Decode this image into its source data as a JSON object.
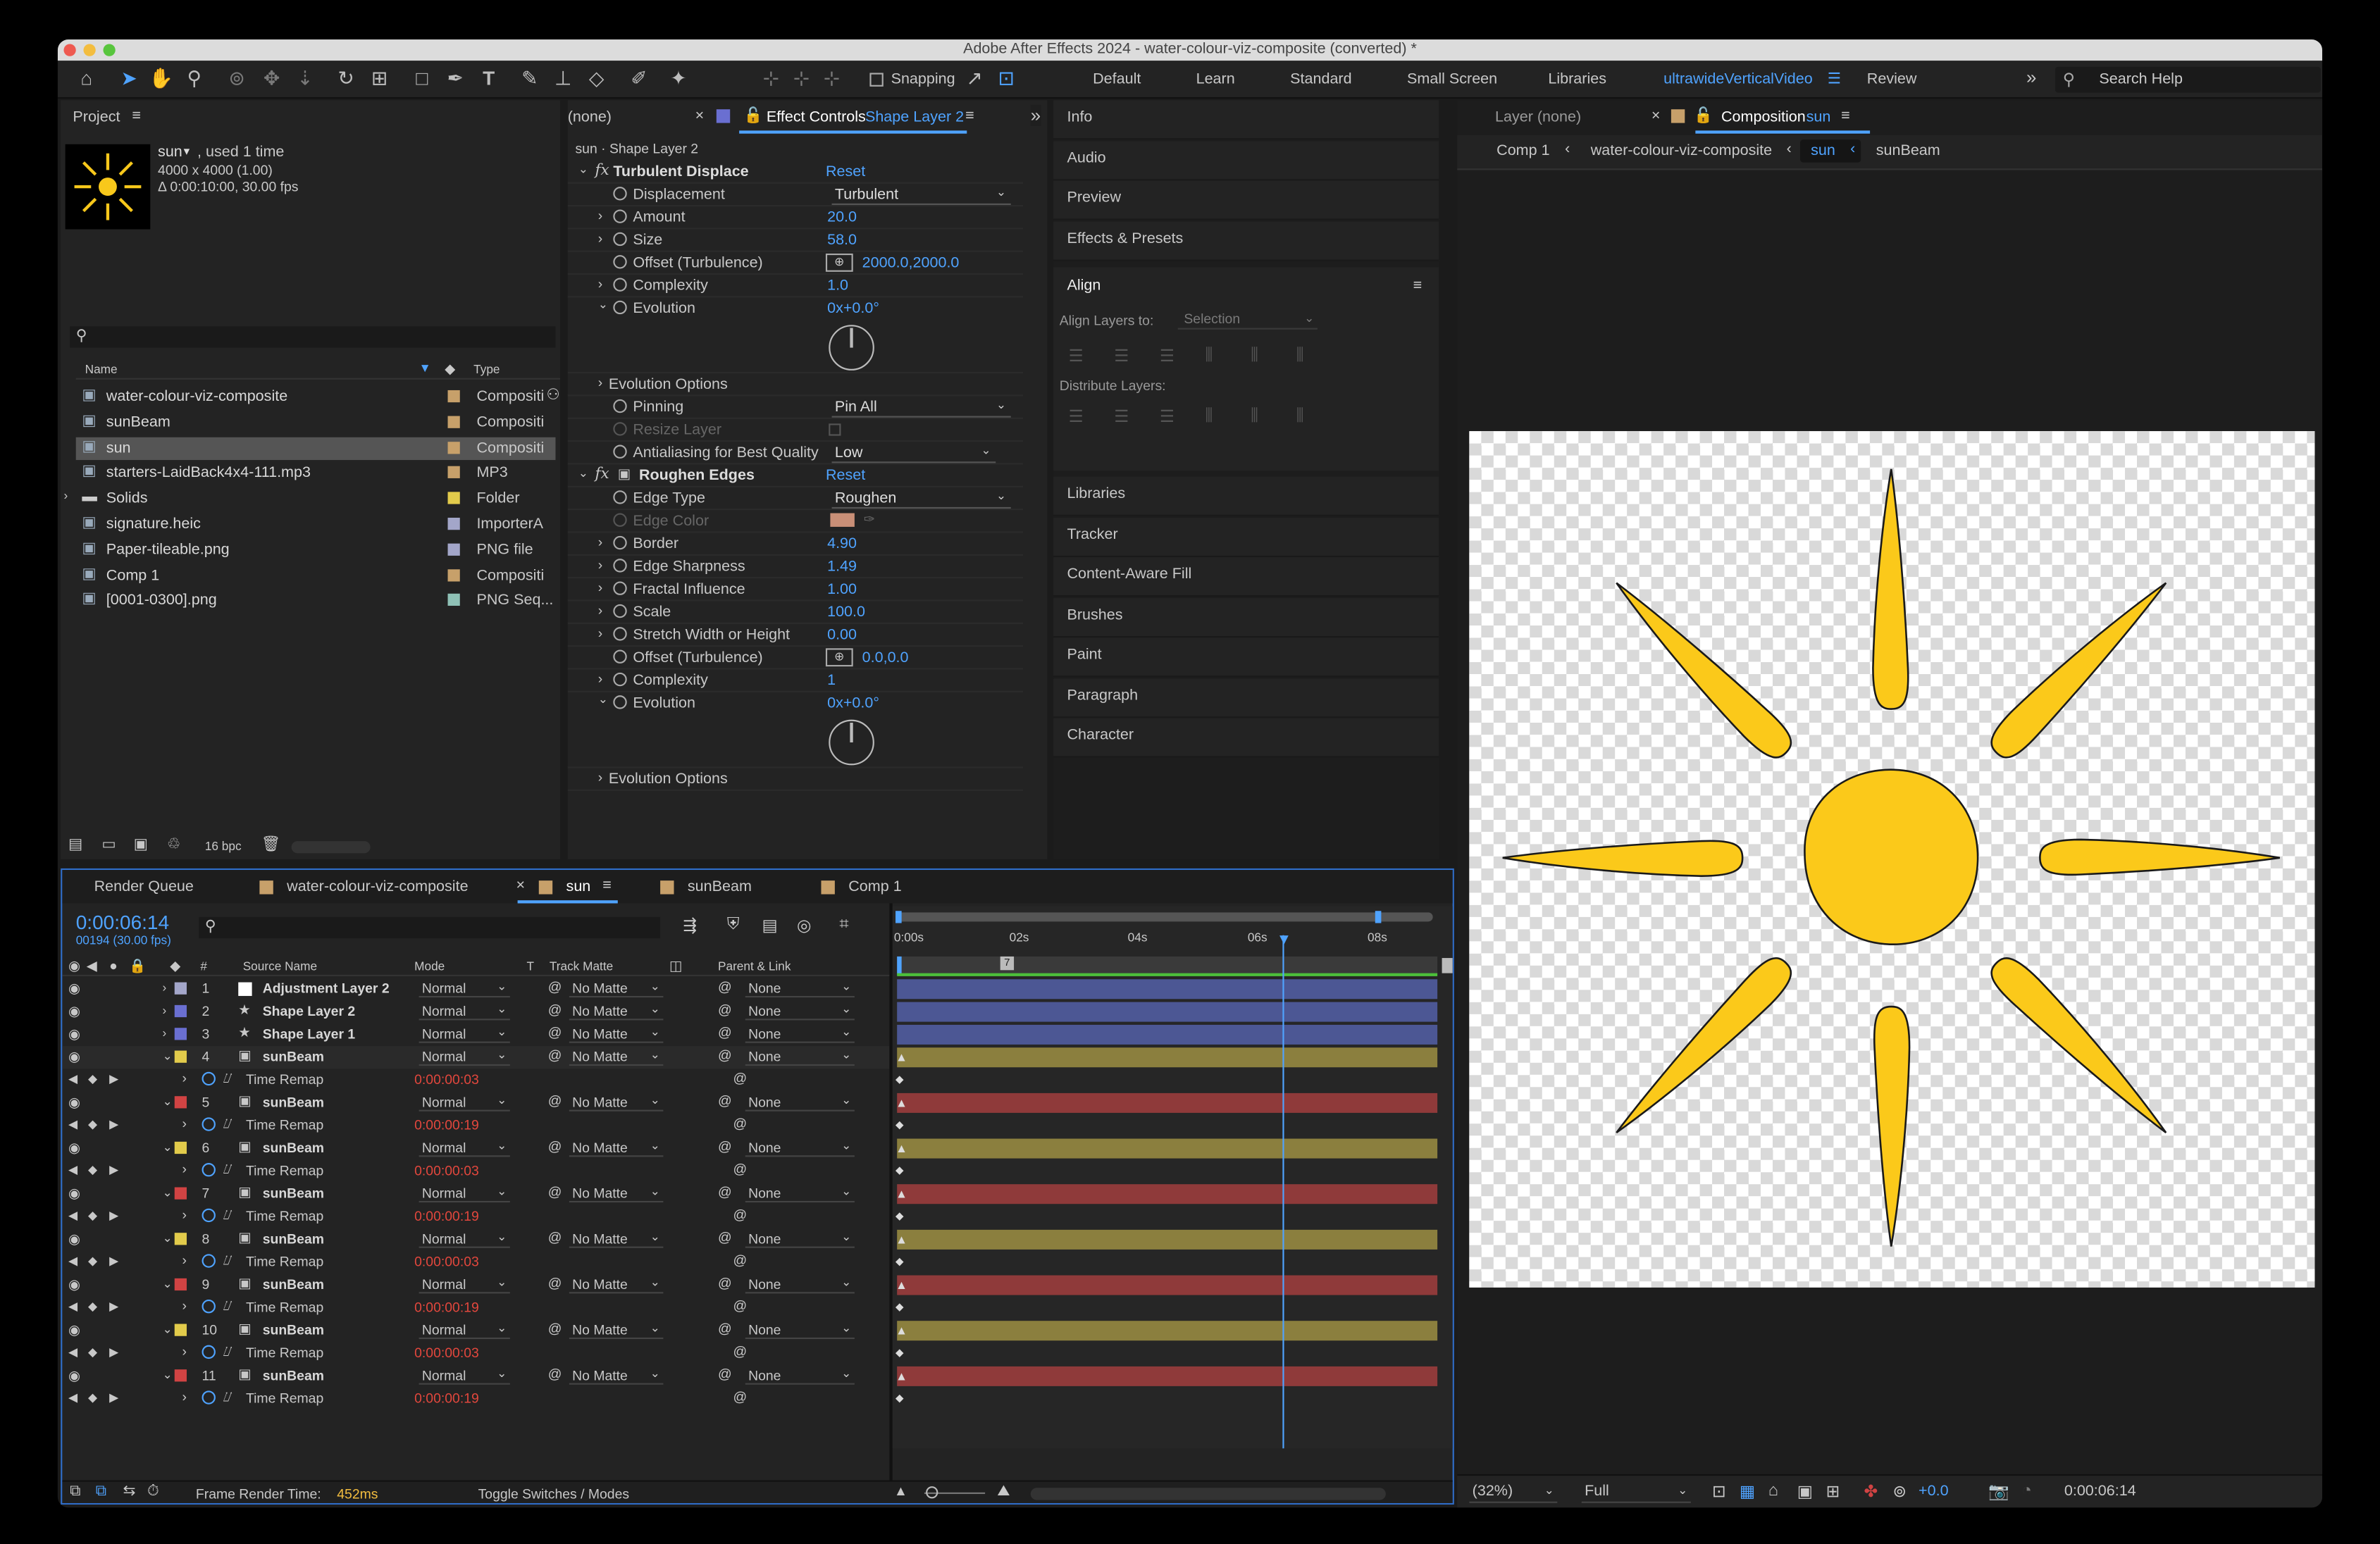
{
  "window": {
    "title": "Adobe After Effects 2024 - water-colour-viz-composite (converted) *"
  },
  "toolbar": {
    "snapping_label": "Snapping",
    "workspaces": [
      "Default",
      "Learn",
      "Standard",
      "Small Screen",
      "Libraries",
      "ultrawideVerticalVideo",
      "Review"
    ],
    "active_workspace": "ultrawideVerticalVideo",
    "search_placeholder": "Search Help",
    "overflow": "»"
  },
  "project": {
    "tab": "Project",
    "item_name": "sun",
    "item_used": ", used 1 time",
    "item_size": "4000 x 4000 (1.00)",
    "item_duration": "Δ 0:00:10:00, 30.00 fps",
    "col_name": "Name",
    "col_type": "Type",
    "items": [
      {
        "name": "water-colour-viz-composite",
        "type": "Compositi",
        "color": "#c7a06a"
      },
      {
        "name": "sunBeam",
        "type": "Compositi",
        "color": "#c7a06a"
      },
      {
        "name": "sun",
        "type": "Compositi",
        "color": "#c7a06a"
      },
      {
        "name": "starters-LaidBack4x4-111.mp3",
        "type": "MP3",
        "color": "#c7a06a"
      },
      {
        "name": "Solids",
        "type": "Folder",
        "color": "#e2cb4b"
      },
      {
        "name": "signature.heic",
        "type": "ImporterA",
        "color": "#a3a6c9"
      },
      {
        "name": "Paper-tileable.png",
        "type": "PNG file",
        "color": "#a3a6c9"
      },
      {
        "name": "Comp 1",
        "type": "Compositi",
        "color": "#c7a06a"
      },
      {
        "name": "[0001-0300].png",
        "type": "PNG Seq...",
        "color": "#8fc1b6"
      }
    ],
    "bpc": "16 bpc"
  },
  "effects": {
    "tab_left": "(none)",
    "tab_label": "Effect Controls",
    "tab_layer": "Shape Layer 2",
    "subtitle": "sun · Shape Layer 2",
    "group1": {
      "name": "Turbulent Displace",
      "reset": "Reset",
      "displacement_label": "Displacement",
      "displacement_value": "Turbulent",
      "amount_label": "Amount",
      "amount": "20.0",
      "size_label": "Size",
      "size": "58.0",
      "offset_label": "Offset (Turbulence)",
      "offset": "2000.0,2000.0",
      "complexity_label": "Complexity",
      "complexity": "1.0",
      "evolution_label": "Evolution",
      "evolution": "0x+0.0°",
      "evo_options": "Evolution Options",
      "pinning_label": "Pinning",
      "pinning": "Pin All",
      "resize_label": "Resize Layer",
      "aa_label": "Antialiasing for Best Quality",
      "aa": "Low"
    },
    "group2": {
      "name": "Roughen Edges",
      "reset": "Reset",
      "edge_type_label": "Edge Type",
      "edge_type": "Roughen",
      "edge_color_label": "Edge Color",
      "border_label": "Border",
      "border": "4.90",
      "sharp_label": "Edge Sharpness",
      "sharp": "1.49",
      "fractal_label": "Fractal Influence",
      "fractal": "1.00",
      "scale_label": "Scale",
      "scale": "100.0",
      "stretch_label": "Stretch Width or Height",
      "stretch": "0.00",
      "offset_label": "Offset (Turbulence)",
      "offset": "0.0,0.0",
      "complexity_label": "Complexity",
      "complexity": "1",
      "evolution_label": "Evolution",
      "evolution": "0x+0.0°",
      "evo_options": "Evolution Options"
    }
  },
  "right_panels": {
    "top": [
      "Info",
      "Audio",
      "Preview",
      "Effects & Presets"
    ],
    "align_title": "Align",
    "align_to_label": "Align Layers to:",
    "align_to_value": "Selection",
    "distribute_label": "Distribute Layers:",
    "bottom": [
      "Libraries",
      "Tracker",
      "Content-Aware Fill",
      "Brushes",
      "Paint",
      "Paragraph",
      "Character"
    ]
  },
  "viewer": {
    "tab_layer": "Layer (none)",
    "tab_comp_label": "Composition",
    "tab_comp_name": "sun",
    "breadcrumbs": [
      "Comp 1",
      "water-colour-viz-composite",
      "sun",
      "sunBeam"
    ],
    "zoom": "(32%)",
    "quality": "Full",
    "exposure": "+0.0",
    "timecode": "0:00:06:14"
  },
  "timeline": {
    "tabs": [
      "Render Queue",
      "water-colour-viz-composite",
      "sun",
      "sunBeam",
      "Comp 1"
    ],
    "active_tab": "sun",
    "timecode": "0:00:06:14",
    "frame_info": "00194 (30.00 fps)",
    "cols": {
      "source": "Source Name",
      "mode": "Mode",
      "t": "T",
      "matte": "Track Matte",
      "parent": "Parent & Link"
    },
    "ruler": [
      "0:00s",
      "02s",
      "04s",
      "06s",
      "08s"
    ],
    "marker": "7",
    "layers": [
      {
        "num": "1",
        "name": "Adjustment Layer 2",
        "mode": "Normal",
        "matte": "No Matte",
        "parent": "None",
        "color": "#a3a6c9",
        "bar": "#4c5794",
        "remap": ""
      },
      {
        "num": "2",
        "name": "Shape Layer 2",
        "mode": "Normal",
        "matte": "No Matte",
        "parent": "None",
        "color": "#6a6fd1",
        "bar": "#4c5794",
        "remap": ""
      },
      {
        "num": "3",
        "name": "Shape Layer 1",
        "mode": "Normal",
        "matte": "No Matte",
        "parent": "None",
        "color": "#6a6fd1",
        "bar": "#4c5794",
        "remap": ""
      },
      {
        "num": "4",
        "name": "sunBeam",
        "mode": "Normal",
        "matte": "No Matte",
        "parent": "None",
        "color": "#e2cb4b",
        "bar": "#8b7f3e",
        "remap": "0:00:00:03"
      },
      {
        "num": "5",
        "name": "sunBeam",
        "mode": "Normal",
        "matte": "No Matte",
        "parent": "None",
        "color": "#d14343",
        "bar": "#8f3a3a",
        "remap": "0:00:00:19"
      },
      {
        "num": "6",
        "name": "sunBeam",
        "mode": "Normal",
        "matte": "No Matte",
        "parent": "None",
        "color": "#e2cb4b",
        "bar": "#8b7f3e",
        "remap": "0:00:00:03"
      },
      {
        "num": "7",
        "name": "sunBeam",
        "mode": "Normal",
        "matte": "No Matte",
        "parent": "None",
        "color": "#d14343",
        "bar": "#8f3a3a",
        "remap": "0:00:00:19"
      },
      {
        "num": "8",
        "name": "sunBeam",
        "mode": "Normal",
        "matte": "No Matte",
        "parent": "None",
        "color": "#e2cb4b",
        "bar": "#8b7f3e",
        "remap": "0:00:00:03"
      },
      {
        "num": "9",
        "name": "sunBeam",
        "mode": "Normal",
        "matte": "No Matte",
        "parent": "None",
        "color": "#d14343",
        "bar": "#8f3a3a",
        "remap": "0:00:00:19"
      },
      {
        "num": "10",
        "name": "sunBeam",
        "mode": "Normal",
        "matte": "No Matte",
        "parent": "None",
        "color": "#e2cb4b",
        "bar": "#8b7f3e",
        "remap": "0:00:00:03"
      },
      {
        "num": "11",
        "name": "sunBeam",
        "mode": "Normal",
        "matte": "No Matte",
        "parent": "None",
        "color": "#d14343",
        "bar": "#8f3a3a",
        "remap": "0:00:00:19"
      }
    ],
    "remap_label": "Time Remap",
    "frame_render_label": "Frame Render Time:",
    "frame_render_value": "452ms",
    "toggle_label": "Toggle Switches / Modes"
  }
}
